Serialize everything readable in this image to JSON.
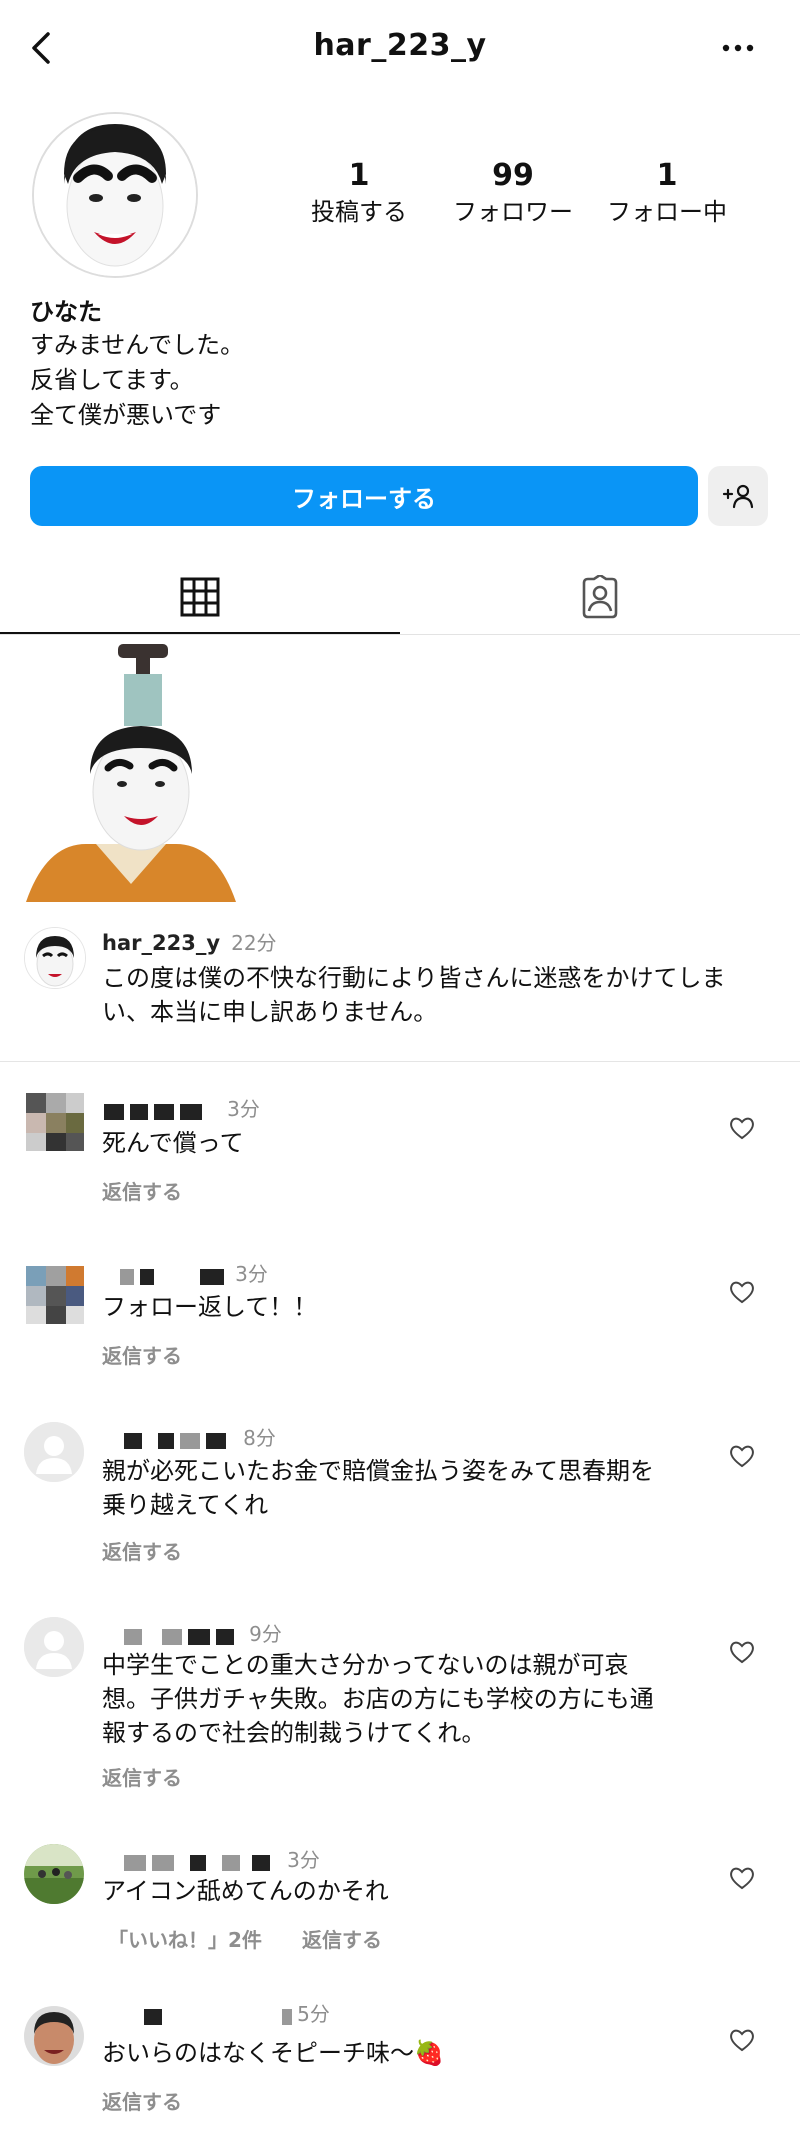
{
  "header": {
    "username": "har_223_y",
    "back_icon": "chevron-left-icon",
    "more_icon": "more-horizontal-icon"
  },
  "profile": {
    "stats": [
      {
        "num": "1",
        "label": "投稿する"
      },
      {
        "num": "99",
        "label": "フォロワー"
      },
      {
        "num": "1",
        "label": "フォロー中"
      }
    ],
    "display_name": "ひなた",
    "bio_lines": [
      "すみませんでした。",
      "反省してます。",
      "全て僕が悪いです"
    ],
    "follow_label": "フォローする"
  },
  "caption": {
    "username": "har_223_y",
    "time": "22分",
    "text_lines": [
      "この度は僕の不快な行動により皆さんに迷惑をかけてしま",
      "い、本当に申し訳ありません。"
    ]
  },
  "comments": [
    {
      "time": "3分",
      "lines": [
        "死んで償って"
      ],
      "reply": "返信する"
    },
    {
      "time": "3分",
      "lines": [
        "フォロー返して！！"
      ],
      "reply": "返信する"
    },
    {
      "time": "8分",
      "lines": [
        "親が必死こいたお金で賠償金払う姿をみて思春期を",
        "乗り越えてくれ"
      ],
      "reply": "返信する"
    },
    {
      "time": "9分",
      "lines": [
        "中学生でことの重大さ分かってないのは親が可哀",
        "想。子供ガチャ失敗。お店の方にも学校の方にも通",
        "報するので社会的制裁うけてくれ。"
      ],
      "reply": "返信する"
    },
    {
      "time": "3分",
      "lines": [
        "アイコン舐めてんのかそれ"
      ],
      "likes": "「いいね！」2件",
      "reply": "返信する"
    },
    {
      "time": "5分",
      "lines": [
        "おいらのはなくそピーチ味〜🍓"
      ],
      "reply": "返信する"
    }
  ],
  "colors": {
    "follow_button": "#0a95f6",
    "muted_text": "#8e8e8e"
  }
}
